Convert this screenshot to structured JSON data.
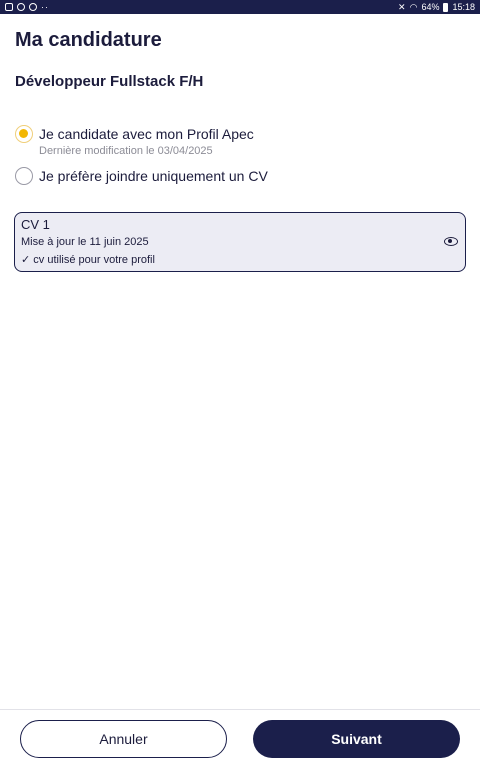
{
  "status_bar": {
    "battery": "64%",
    "time": "15:18"
  },
  "page": {
    "title": "Ma candidature",
    "job_title": "Développeur Fullstack F/H"
  },
  "options": [
    {
      "label": "Je candidate avec mon Profil Apec",
      "sublabel": "Dernière modification  le 03/04/2025",
      "selected": true
    },
    {
      "label": "Je préfère joindre uniquement un CV",
      "selected": false
    }
  ],
  "cv": {
    "title": "CV 1",
    "updated": "Mise à jour le 11 juin 2025",
    "usage": "✓ cv utilisé pour votre profil",
    "icon": "eye-icon"
  },
  "footer": {
    "cancel_label": "Annuler",
    "next_label": "Suivant"
  },
  "colors": {
    "primary": "#1b1f4b",
    "accent": "#f2b705",
    "card_bg": "#ececf4"
  }
}
